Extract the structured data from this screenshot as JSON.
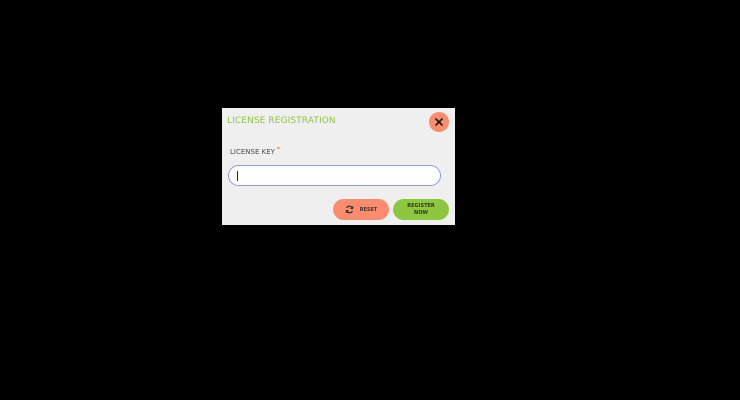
{
  "dialog": {
    "title": "LICENSE REGISTRATION",
    "close_icon": "close-icon",
    "license_key": {
      "label": "LICENSE KEY",
      "required_mark": "*",
      "value": "",
      "placeholder": ""
    },
    "buttons": {
      "reset_label": "RESET",
      "reset_icon": "refresh-icon",
      "register_label": "REGISTER\nNOW"
    }
  },
  "colors": {
    "backdrop": "#000000",
    "dialog_bg": "#efefef",
    "title": "#8dc63f",
    "close_button": "#fb8c6e",
    "reset_button": "#fb8c6e",
    "register_button": "#8dc63f",
    "input_border": "#8f9bdc",
    "required": "#ff4f2e"
  }
}
